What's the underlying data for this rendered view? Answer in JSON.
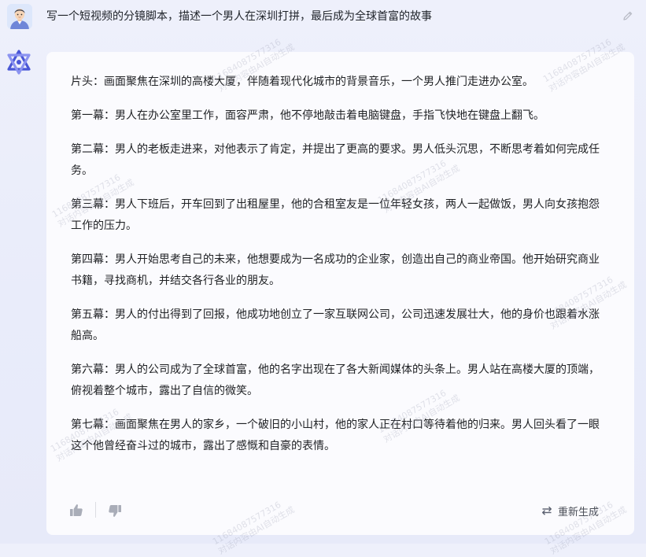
{
  "user": {
    "prompt": "写一个短视频的分镜脚本，描述一个男人在深圳打拼，最后成为全球首富的故事",
    "avatar_icon": "user-avatar-icon",
    "edit_icon": "edit-pencil-icon"
  },
  "assistant": {
    "logo_icon": "assistant-logo-icon",
    "paragraphs": [
      "片头：画面聚焦在深圳的高楼大厦，伴随着现代化城市的背景音乐，一个男人推门走进办公室。",
      "第一幕：男人在办公室里工作，面容严肃，他不停地敲击着电脑键盘，手指飞快地在键盘上翻飞。",
      "第二幕：男人的老板走进来，对他表示了肯定，并提出了更高的要求。男人低头沉思，不断思考着如何完成任务。",
      "第三幕：男人下班后，开车回到了出租屋里，他的合租室友是一位年轻女孩，两人一起做饭，男人向女孩抱怨工作的压力。",
      "第四幕：男人开始思考自己的未来，他想要成为一名成功的企业家，创造出自己的商业帝国。他开始研究商业书籍，寻找商机，并结交各行各业的朋友。",
      "第五幕：男人的付出得到了回报，他成功地创立了一家互联网公司，公司迅速发展壮大，他的身价也跟着水涨船高。",
      "第六幕：男人的公司成为了全球首富，他的名字出现在了各大新闻媒体的头条上。男人站在高楼大厦的顶端，俯视着整个城市，露出了自信的微笑。",
      "第七幕：画面聚焦在男人的家乡，一个破旧的小山村，他的家人正在村口等待着他的归来。男人回头看了一眼这个他曾经奋斗过的城市，露出了感慨和自豪的表情。"
    ],
    "footer": {
      "like_icon": "thumbs-up-icon",
      "dislike_icon": "thumbs-down-icon",
      "regenerate_icon": "regenerate-icon",
      "regenerate_label": "重新生成"
    }
  },
  "watermark": {
    "id_text": "11684087577316",
    "note_text": "对话内容由AI自动生成"
  },
  "colors": {
    "page_background": "#ebedfa",
    "card_background": "#fbfbfe",
    "logo_primary": "#4a57d6",
    "logo_secondary": "#8b93f0"
  }
}
